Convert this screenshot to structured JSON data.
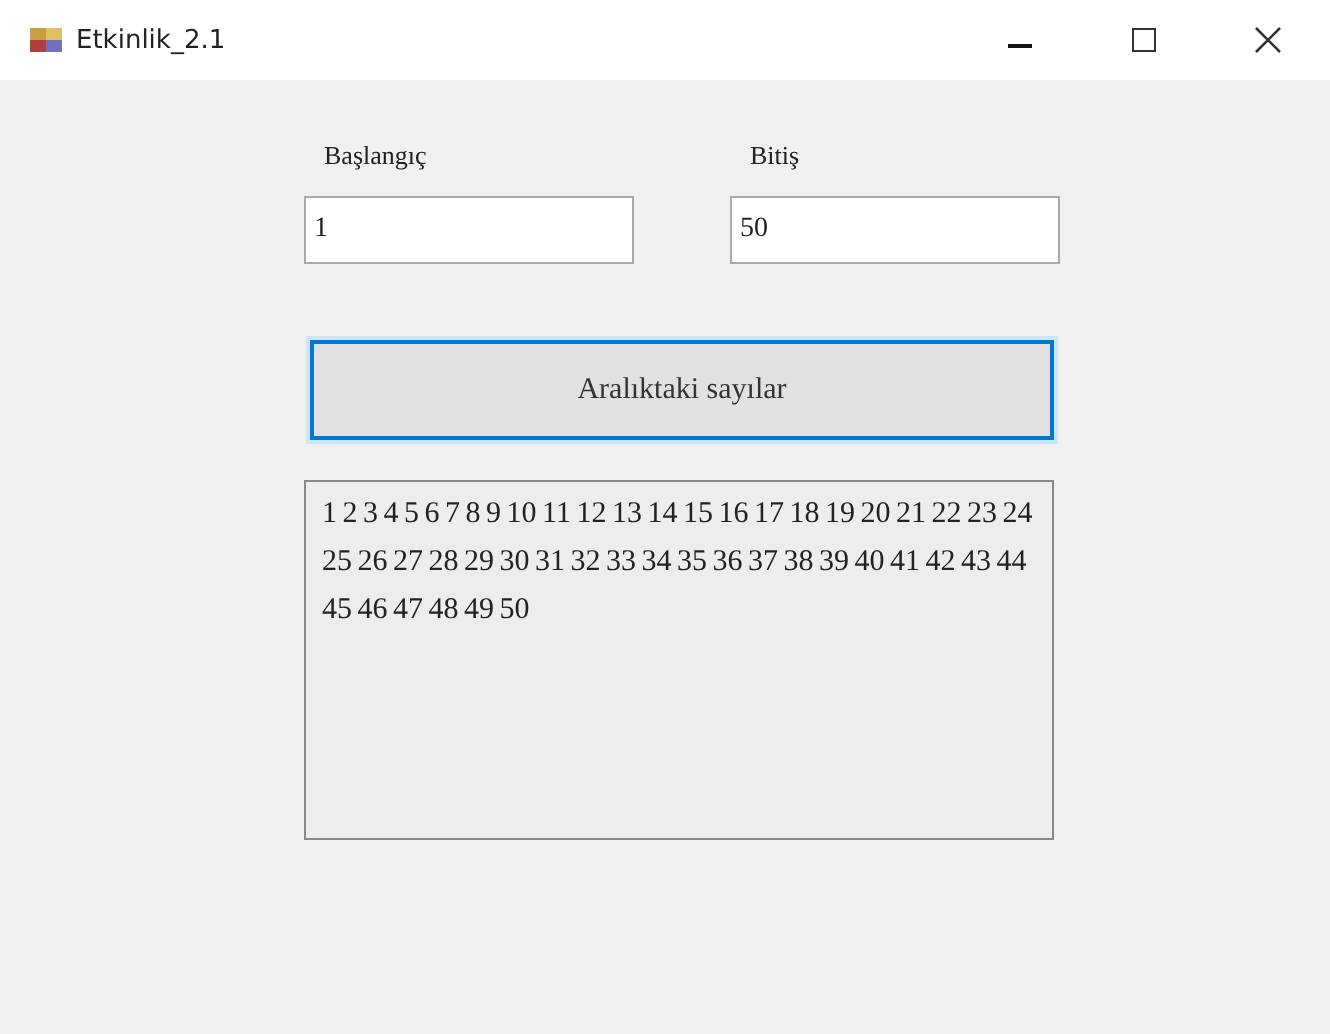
{
  "window": {
    "title": "Etkinlik_2.1"
  },
  "start": {
    "label": "Başlangıç",
    "value": "1"
  },
  "end": {
    "label": "Bitiş",
    "value": "50"
  },
  "button": {
    "label": "Aralıktaki sayılar",
    "focused": true
  },
  "output": {
    "text": "1 2 3 4 5 6 7 8 9 10 11 12 13 14 15 16 17 18 19 20 21 22 23 24 25 26 27 28 29 30 31 32 33 34 35 36 37 38 39 40 41 42 43 44 45 46 47 48 49 50"
  }
}
